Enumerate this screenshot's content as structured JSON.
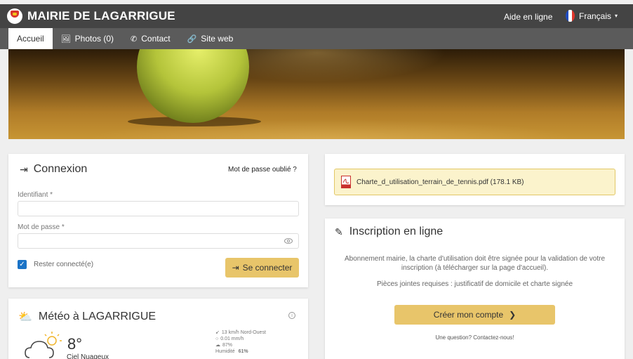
{
  "header": {
    "title": "MAIRIE DE LAGARRIGUE",
    "help_label": "Aide en ligne",
    "language": "Français",
    "flag_colors": [
      "#1f4bbf",
      "#ffffff",
      "#e0352b"
    ]
  },
  "tabs": [
    {
      "label": "Accueil",
      "icon": "home",
      "active": true
    },
    {
      "label": "Photos (0)",
      "icon": "image-icon"
    },
    {
      "label": "Contact",
      "icon": "phone-icon"
    },
    {
      "label": "Site web",
      "icon": "link-icon"
    }
  ],
  "login": {
    "title": "Connexion",
    "forgot_label": "Mot de passe oublié ?",
    "username_label": "Identifiant *",
    "username_value": "",
    "password_label": "Mot de passe *",
    "password_value": "",
    "remember_label": "Rester connecté(e)",
    "remember_checked": true,
    "submit_label": "Se connecter"
  },
  "weather": {
    "title": "Météo à LAGARRIGUE",
    "temperature": "8°",
    "condition": "Ciel Nuageux",
    "wind": "13 km/h Nord-Ouest",
    "rain": "0.01 mm/h",
    "clouds": "87%",
    "humidity_label": "Humidité",
    "humidity_value": "61%"
  },
  "attachment": {
    "file_name": "Charte_d_utilisation_terrain_de_tennis.pdf (178.1 KB)"
  },
  "registration": {
    "title": "Inscription en ligne",
    "description": "Abonnement mairie, la charte d'utilisation doit être signée pour la validation de votre inscription (à télécharger sur la page d'accueil).",
    "required_docs": "Pièces jointes requises : justificatif de domicile et charte signée",
    "create_label": "Créer mon compte",
    "question": "Une question? Contactez-nous!"
  },
  "colors": {
    "accent": "#e8c56a",
    "checkbox": "#1a73c7",
    "topbar": "#444444",
    "tabbar": "#5b5b5b"
  }
}
